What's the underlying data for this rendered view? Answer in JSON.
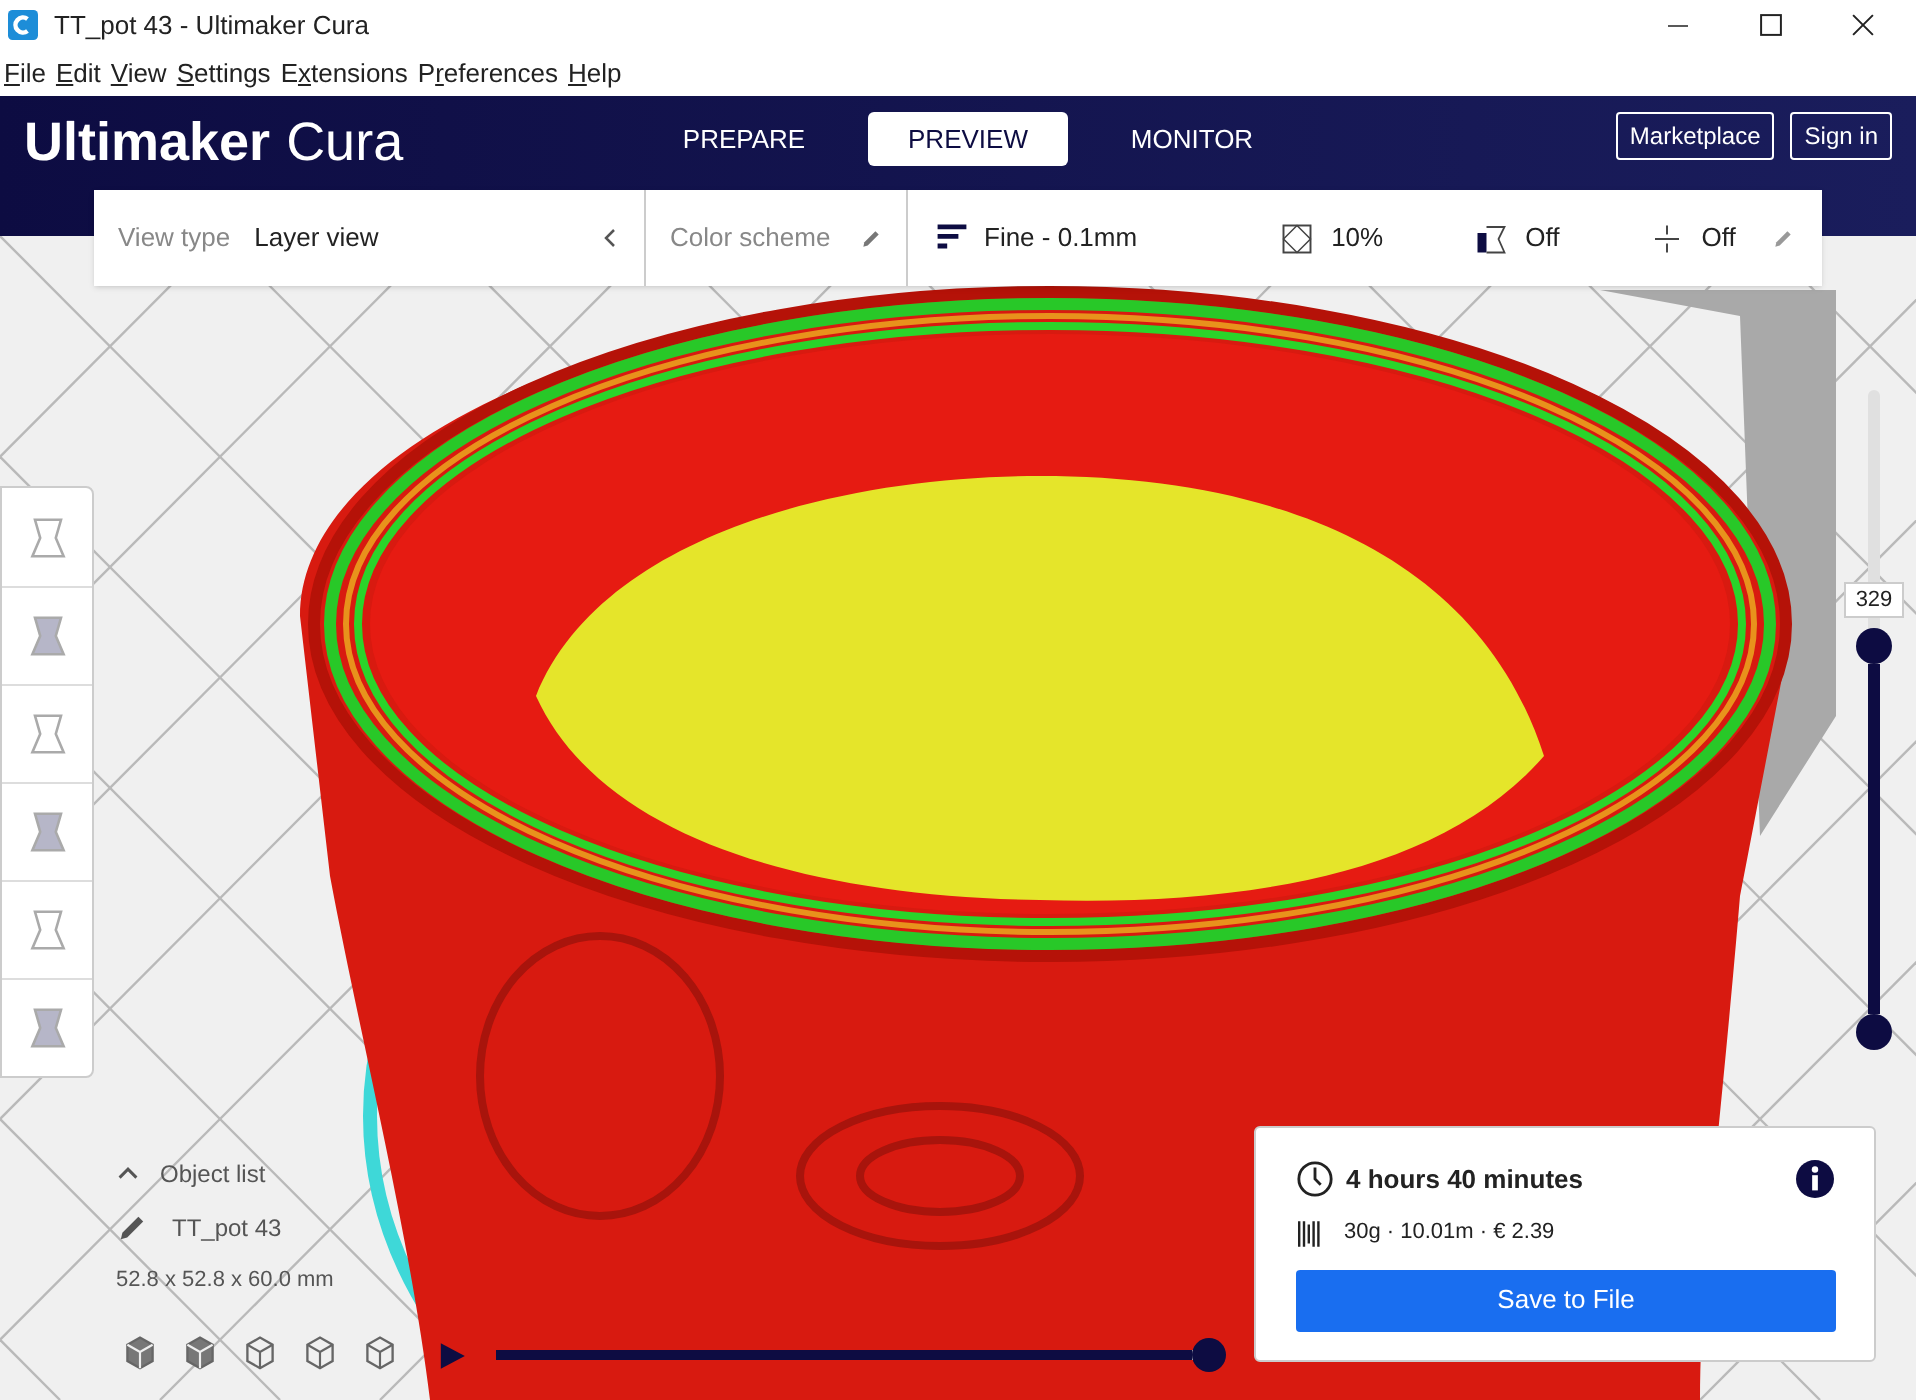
{
  "window": {
    "title": "TT_pot 43  - Ultimaker Cura"
  },
  "menu": [
    {
      "key": "F",
      "rest": "ile"
    },
    {
      "key": "E",
      "rest": "dit"
    },
    {
      "key": "V",
      "rest": "iew"
    },
    {
      "key": "S",
      "rest": "ettings"
    },
    {
      "pre": "E",
      "key": "x",
      "rest": "tensions"
    },
    {
      "pre": "P",
      "key": "r",
      "rest": "eferences"
    },
    {
      "key": "H",
      "rest": "elp"
    }
  ],
  "header": {
    "logo_bold": "Ultimaker",
    "logo_light": "Cura",
    "stages": [
      {
        "label": "PREPARE",
        "selected": false
      },
      {
        "label": "PREVIEW",
        "selected": true
      },
      {
        "label": "MONITOR",
        "selected": false
      }
    ],
    "buttons": [
      "Marketplace",
      "Sign in"
    ]
  },
  "view_toolbar": {
    "view_type_label": "View type",
    "view_type_value": "Layer view",
    "color_scheme": "Color scheme",
    "profile": "Fine - 0.1mm",
    "infill": "10%",
    "support": "Off",
    "adhesion": "Off"
  },
  "tools": [
    {
      "selected": false
    },
    {
      "selected": false
    },
    {
      "selected": false
    },
    {
      "selected": false
    },
    {
      "selected": false
    },
    {
      "selected": false
    }
  ],
  "layer_slider": {
    "reading": "329",
    "level": 0.6
  },
  "object_list": {
    "label": "Object list",
    "expanded": false,
    "object_name": "TT_pot 43",
    "dimensions": "52.8 x 52.8 x 60.0 mm"
  },
  "simulation": {
    "playing": false,
    "level": 1
  },
  "print_info": {
    "time": "4 hours 40 minutes",
    "material": "30g · 10.01m · € 2.39",
    "button": "Save to File"
  }
}
